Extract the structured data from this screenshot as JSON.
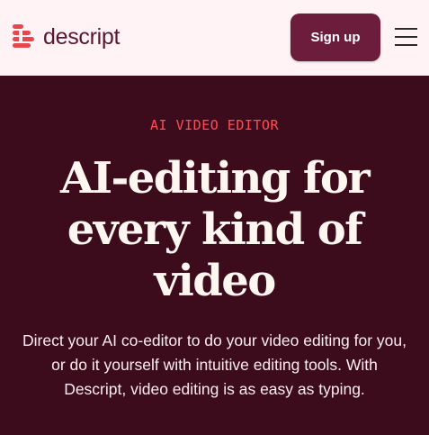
{
  "header": {
    "logo_text": "descript",
    "signup_label": "Sign up"
  },
  "hero": {
    "eyebrow": "AI VIDEO EDITOR",
    "headline": "AI-editing for every kind of video",
    "subtext": "Direct your AI co-editor to do your video editing for you, or do it yourself with intuitive editing tools. With Descript, video editing is as easy as typing."
  },
  "colors": {
    "header_bg": "#fff3f6",
    "hero_bg": "#3d0c1c",
    "brand": "#6b1d3b",
    "eyebrow": "#ff4d55",
    "logo_mark": "#e8464e"
  },
  "icons": {
    "logo": "descript-logo-icon",
    "menu": "hamburger-menu-icon"
  }
}
